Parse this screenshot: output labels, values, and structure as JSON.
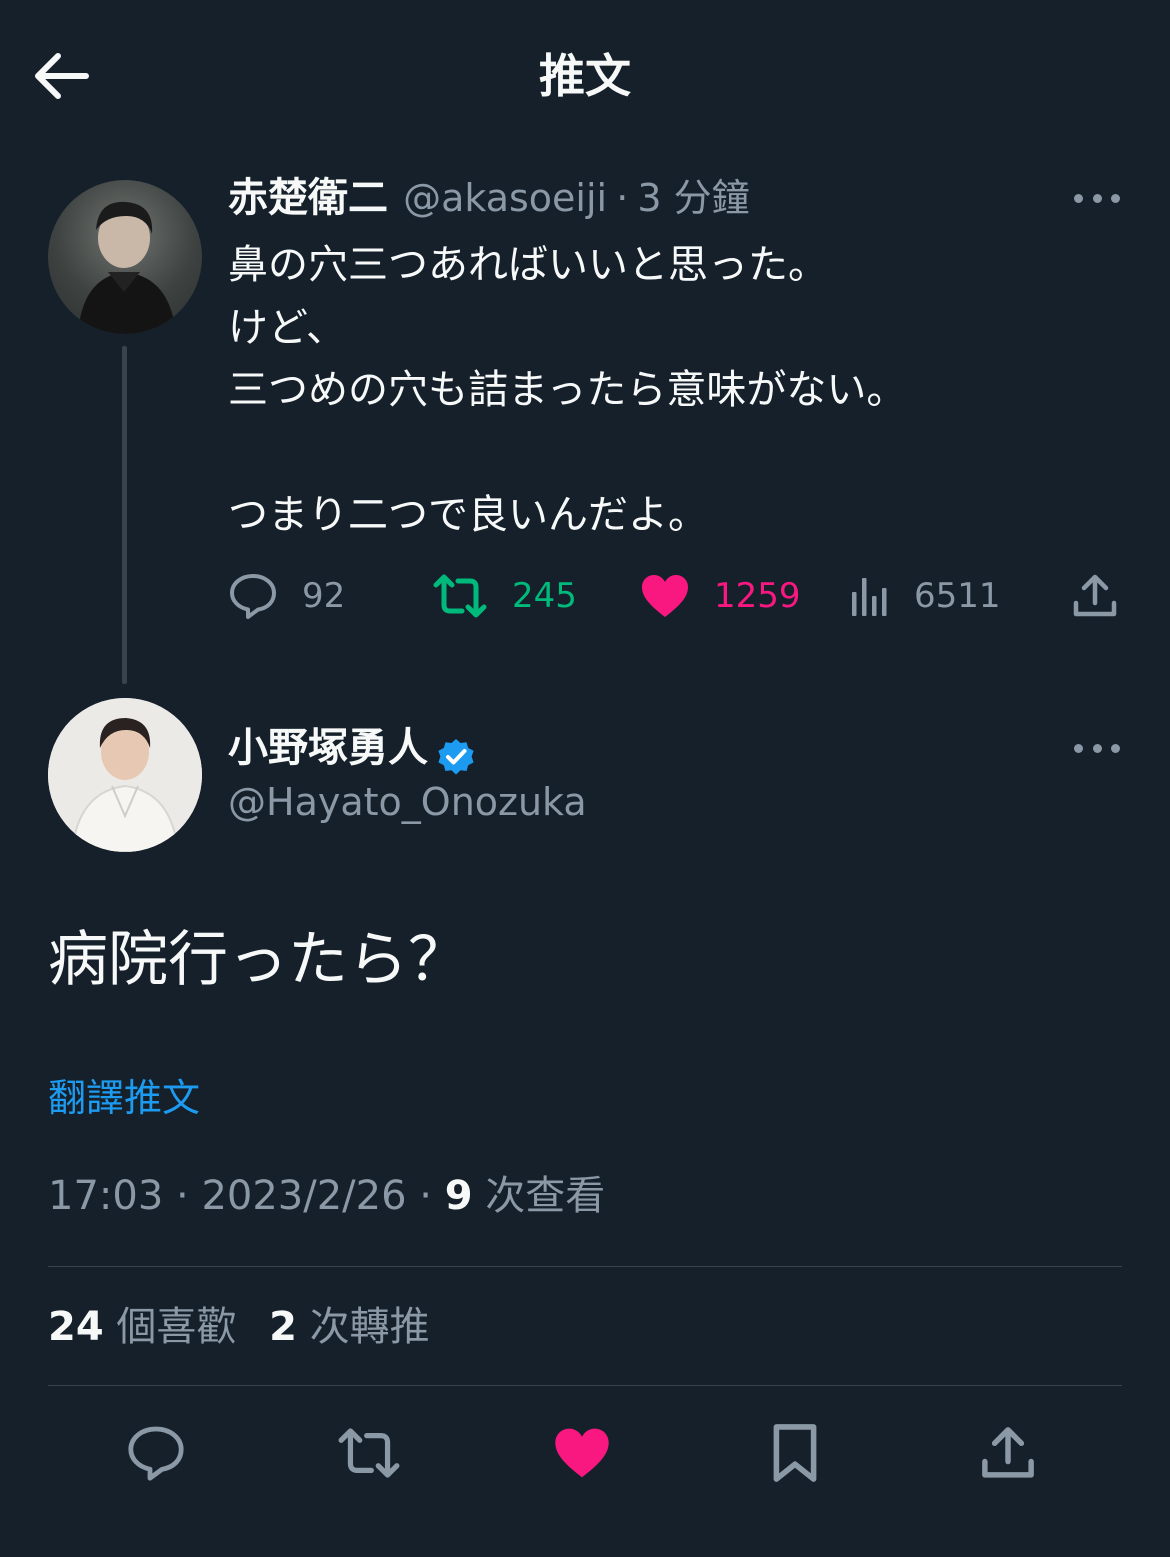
{
  "header": {
    "title": "推文"
  },
  "parent_tweet": {
    "author_name": "赤楚衛二",
    "handle": "@akasoeiji",
    "separator": "·",
    "time": "3 分鐘",
    "text": "鼻の穴三つあればいいと思った。\nけど、\n三つめの穴も詰まったら意味がない。\n\nつまり二つで良いんだよ。",
    "replies": "92",
    "retweets": "245",
    "likes": "1259",
    "views": "6511"
  },
  "main_tweet": {
    "author_name": "小野塚勇人",
    "handle": "@Hayato_Onozuka",
    "text": "病院行ったら？",
    "translate_label": "翻譯推文",
    "time": "17:03",
    "date": "2023/2/26",
    "views_count": "9",
    "views_label": "次查看",
    "likes_count": "24",
    "likes_label": "個喜歡",
    "retweets_count": "2",
    "retweets_label": "次轉推"
  },
  "colors": {
    "background": "#15202b",
    "text": "#f7f9f9",
    "muted": "#8b98a5",
    "link": "#1d9bf0",
    "retweet": "#00ba7c",
    "like": "#f91880",
    "divider": "#38444d"
  }
}
